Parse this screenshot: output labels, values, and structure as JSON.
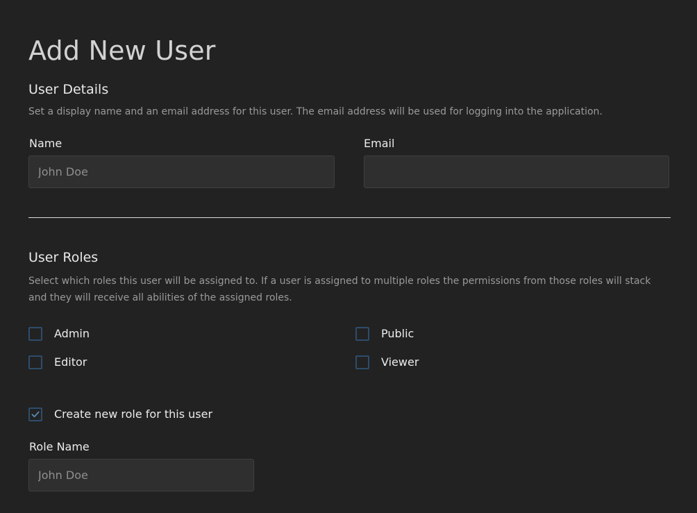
{
  "page": {
    "title": "Add New User"
  },
  "user_details": {
    "title": "User Details",
    "description": "Set a display name and an email address for this user. The email address will be used for logging into the application.",
    "name_label": "Name",
    "name_placeholder": "John Doe",
    "name_value": "",
    "email_label": "Email",
    "email_placeholder": "",
    "email_value": ""
  },
  "user_roles": {
    "title": "User Roles",
    "description": "Select which roles this user will be assigned to. If a user is assigned to multiple roles the permissions from those roles will stack and they will receive all abilities of the assigned roles.",
    "roles": [
      {
        "label": "Admin",
        "checked": false
      },
      {
        "label": "Public",
        "checked": false
      },
      {
        "label": "Editor",
        "checked": false
      },
      {
        "label": "Viewer",
        "checked": false
      }
    ],
    "create_role_label": "Create new role for this user",
    "create_role_checked": true,
    "role_name_label": "Role Name",
    "role_name_placeholder": "John Doe",
    "role_name_value": ""
  },
  "colors": {
    "background": "#222222",
    "input_background": "#2f2f2f",
    "checkbox_border": "#2d4d6b",
    "check_mark": "#5d8bb3"
  },
  "icons": {
    "checked": "check-icon"
  }
}
